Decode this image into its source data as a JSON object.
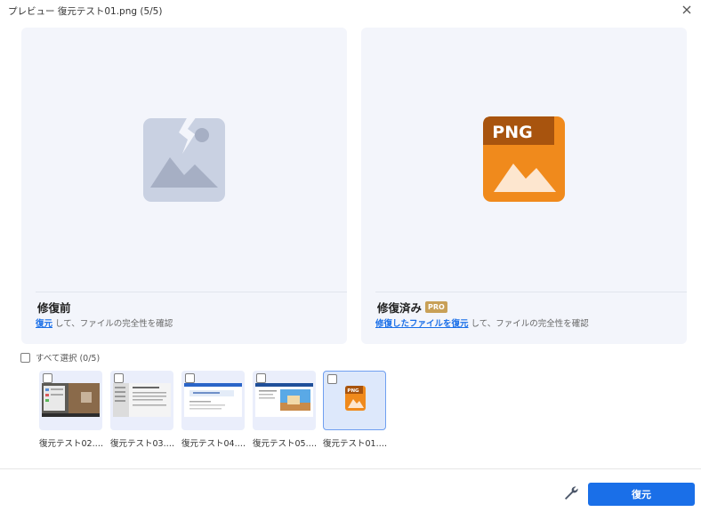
{
  "window": {
    "title": "プレビュー 復元テスト01.png (5/5)"
  },
  "before_panel": {
    "heading": "修復前",
    "link_text": "復元",
    "desc_rest": " して、ファイルの完全性を確認"
  },
  "after_panel": {
    "heading": "修復済み",
    "badge": "PRO",
    "icon_text": "PNG",
    "link_text": "修復したファイルを復元",
    "desc_rest": " して、ファイルの完全性を確認"
  },
  "select_all": {
    "label": "すべて選択 (0/5)"
  },
  "thumbnails": [
    {
      "label": "復元テスト02.…"
    },
    {
      "label": "復元テスト03.…"
    },
    {
      "label": "復元テスト04.…"
    },
    {
      "label": "復元テスト05.…"
    },
    {
      "label": "復元テスト01.…",
      "icon_text": "PNG"
    }
  ],
  "footer": {
    "recover_label": "復元"
  },
  "colors": {
    "accent": "#1a6fe8",
    "png_orange": "#f08a1c",
    "pro_badge": "#c8a057"
  }
}
